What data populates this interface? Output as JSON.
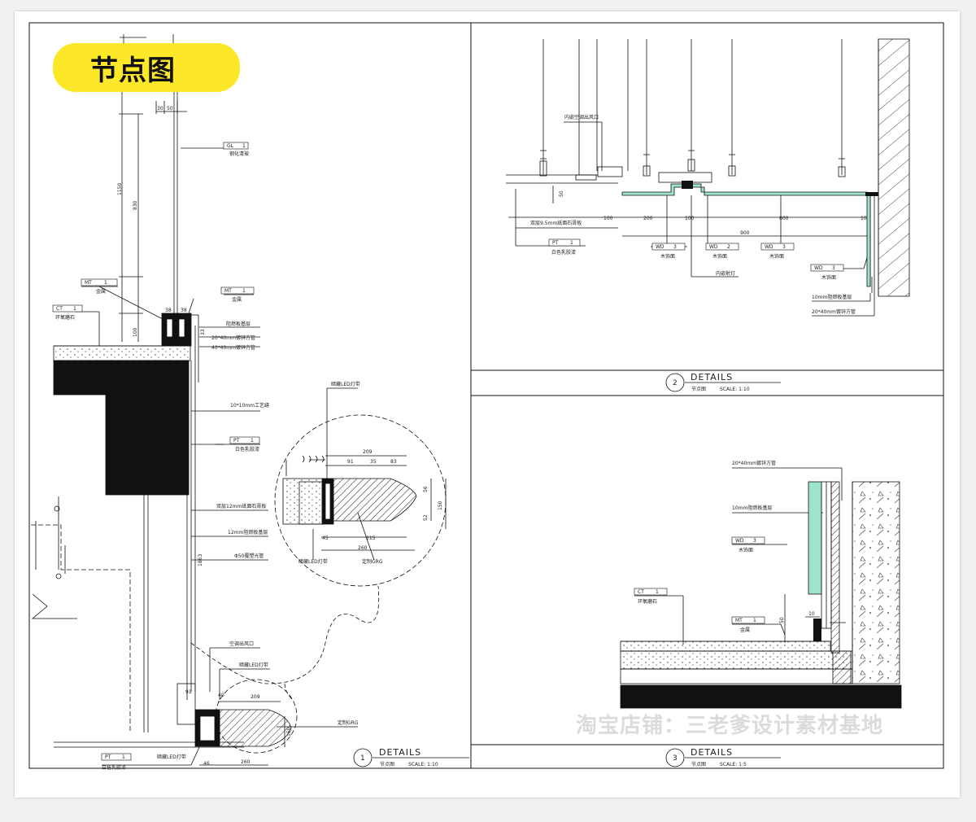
{
  "badge": {
    "title": "节点图",
    "color": "#fce729"
  },
  "watermark": "淘宝店铺：三老爹设计素材基地",
  "detail1": {
    "number": "1",
    "heading": "DETAILS",
    "subtitle": "节点图",
    "scale": "SCALE: 1:10",
    "tags": {
      "gl": [
        "GL",
        "1"
      ],
      "mt_left": [
        "MT",
        "1"
      ],
      "mt_right": [
        "MT",
        "1"
      ],
      "ct": [
        "CT",
        "1"
      ],
      "pt_mid": [
        "PT",
        "1"
      ],
      "pt_bottom": [
        "PT",
        "1"
      ]
    },
    "labels": {
      "gl": "钢化清玻",
      "mt_left": "金属",
      "mt_right": "金属",
      "ct": "环氧磨石",
      "layer1": "阻燃板基层",
      "layer2": "20*40mm镀锌方管",
      "layer3": "40*40mm镀锌方管",
      "groove": "10*10mm工艺缝",
      "pt_mid": "白色乳胶漆",
      "gypsum": "双层12mm纸面石膏板",
      "base": "12mm阻燃板基层",
      "pipe": "Φ50覆塑光管",
      "vent": "空调出风口",
      "led_top": "暗藏LED灯带",
      "grg": "定制GRG",
      "led_bottom": "暗藏LED灯带",
      "pt_bottom": "白色乳胶漆",
      "zoom_led": "暗藏LED灯带",
      "zoom_led2": "暗藏LED灯带",
      "zoom_grg": "定制GRG"
    },
    "dims": {
      "d30": "30",
      "d50": "50",
      "d1150": "1150",
      "d830": "830",
      "d100": "100",
      "d38a": "38",
      "d38b": "38",
      "d33": "33",
      "d1863": "1863",
      "d91": "91",
      "d40": "40",
      "d209": "209",
      "d150": "150",
      "d260": "260",
      "d46": "46",
      "z209": "209",
      "z91": "91",
      "z35": "35",
      "z83": "83",
      "z56": "56",
      "z52": "52",
      "z150": "150",
      "z45": "45",
      "z215": "215",
      "z260": "260"
    }
  },
  "detail2": {
    "number": "2",
    "heading": "DETAILS",
    "subtitle": "节点图",
    "scale": "SCALE: 1:10",
    "tags": {
      "pt": [
        "PT",
        "1"
      ],
      "wd_a": [
        "WD",
        "3"
      ],
      "wd_b": [
        "WD",
        "2"
      ],
      "wd_c": [
        "WD",
        "3"
      ],
      "wd_d": [
        "WD",
        "3"
      ]
    },
    "labels": {
      "vent": "内嵌空调出风口",
      "gypsum": "双层9.5mm纸面石膏板",
      "pt": "白色乳胶漆",
      "wd_a": "木饰面",
      "wd_b": "木饰面",
      "wd_c": "木饰面",
      "wd_d": "木饰面",
      "led": "内嵌射灯",
      "base": "10mm阻燃板基层",
      "pipe": "20*40mm镀锌方管"
    },
    "dims": {
      "d50": "50",
      "d100a": "100",
      "d200": "200",
      "d100b": "100",
      "d600": "600",
      "d10": "10",
      "d900": "900"
    }
  },
  "detail3": {
    "number": "3",
    "heading": "DETAILS",
    "subtitle": "节点图",
    "scale": "SCALE: 1:5",
    "tags": {
      "wd": [
        "WD",
        "3"
      ],
      "ct": [
        "CT",
        "1"
      ],
      "mt": [
        "MT",
        "1"
      ]
    },
    "labels": {
      "pipe": "20*40mm镀锌方管",
      "base": "10mm阻燃板基层",
      "wd": "木饰面",
      "ct": "环氧磨石",
      "mt": "金属"
    },
    "dims": {
      "d50": "50",
      "d10": "10"
    }
  },
  "colors": {
    "accent_green": "#9fe3cf",
    "ink": "#111111"
  }
}
